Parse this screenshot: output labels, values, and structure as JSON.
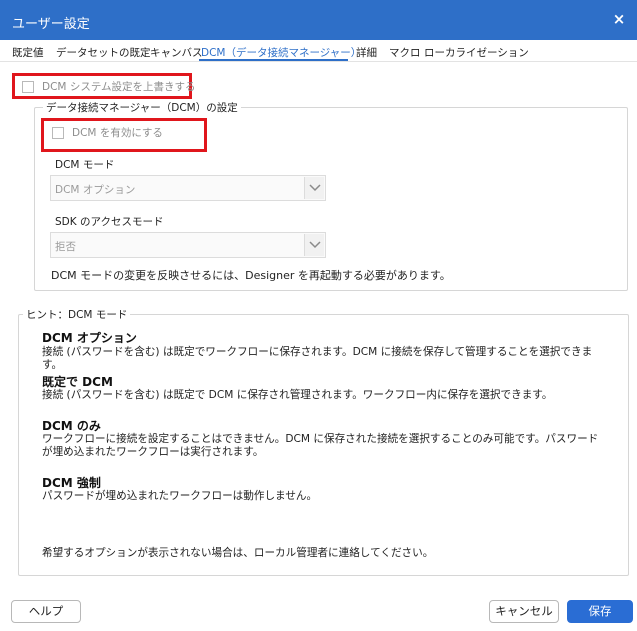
{
  "window": {
    "title": "ユーザー設定",
    "close_label": "×"
  },
  "tabs": [
    {
      "label": "既定値",
      "active": false
    },
    {
      "label": "データセットの既定",
      "active": false
    },
    {
      "label": "キャンバス",
      "active": false
    },
    {
      "label": "DCM（データ接続マネージャー）",
      "active": true
    },
    {
      "label": "詳細",
      "active": false
    },
    {
      "label": "マクロ",
      "active": false
    },
    {
      "label": "ローカライゼーション",
      "active": false
    }
  ],
  "override_checkbox": {
    "label": "DCM システム設定を上書きする",
    "checked": false,
    "enabled": false
  },
  "dcm_group": {
    "legend": "データ接続マネージャー（DCM）の設定",
    "enable_checkbox": {
      "label": "DCM を有効にする",
      "checked": false,
      "enabled": false
    },
    "mode": {
      "label": "DCM モード",
      "value": "DCM オプション"
    },
    "sdk_mode": {
      "label": "SDK のアクセスモード",
      "value": "拒否"
    },
    "restart_note": "DCM モードの変更を反映させるには、Designer を再起動する必要があります。"
  },
  "hint_group": {
    "legend": "ヒント：DCM モード",
    "items": [
      {
        "title": "DCM オプション",
        "text": "接続 (パスワードを含む) は既定でワークフローに保存されます。DCM に接続を保存して管理することを選択できます。"
      },
      {
        "title": "既定で DCM",
        "text": "接続 (パスワードを含む) は既定で DCM に保存され管理されます。ワークフロー内に保存を選択できます。"
      },
      {
        "title": "DCM のみ",
        "text": "ワークフローに接続を設定することはできません。DCM に保存された接続を選択することのみ可能です。パスワードが埋め込まれたワークフローは実行されます。"
      },
      {
        "title": "DCM 強制",
        "text": "パスワードが埋め込まれたワークフローは動作しません。"
      }
    ],
    "footer": "希望するオプションが表示されない場合は、ローカル管理者に連絡してください。"
  },
  "buttons": {
    "help": "ヘルプ",
    "cancel": "キャンセル",
    "save": "保存"
  },
  "colors": {
    "accent": "#2e6fc8",
    "highlight": "#e0161c",
    "save_button": "#2a6dd4"
  }
}
